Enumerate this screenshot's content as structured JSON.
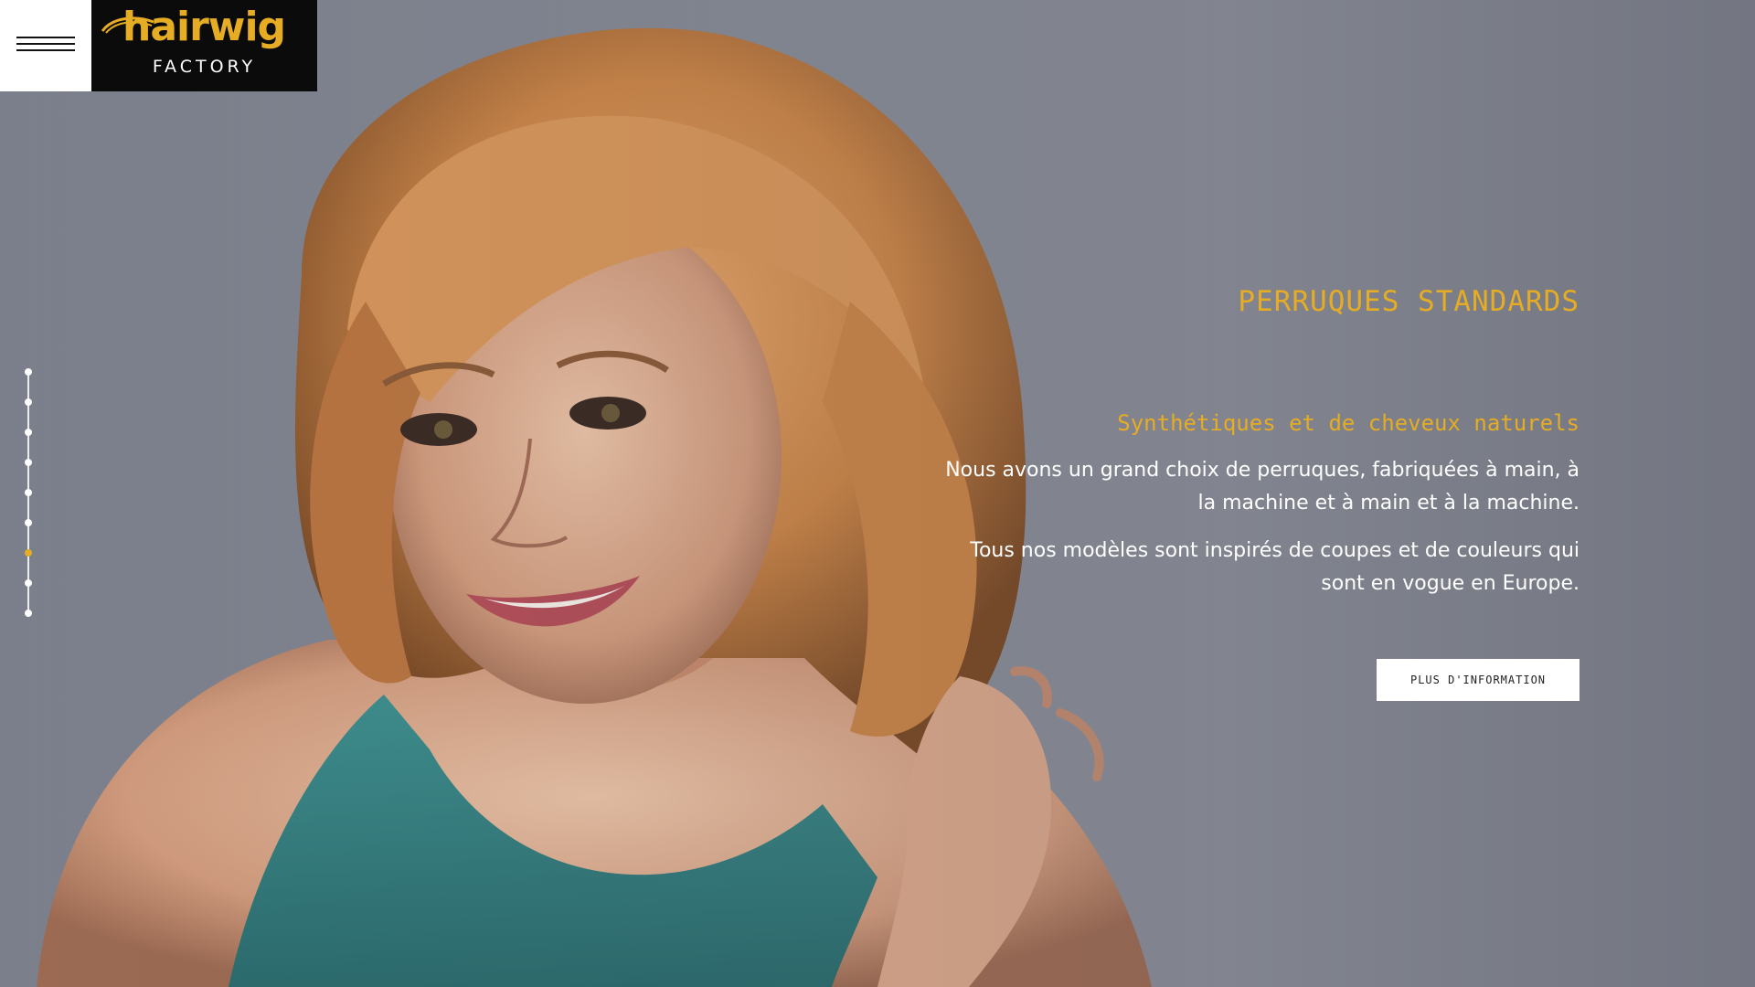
{
  "brand": {
    "logo_main": "hairwig",
    "logo_sub": "FACTORY"
  },
  "header": {
    "menu_icon": "hamburger-menu-icon"
  },
  "dot_nav": {
    "count": 9,
    "active_index": 6,
    "active_color": "#e5ac24"
  },
  "hero": {
    "title": "PERRUQUES STANDARDS",
    "subtitle": "Synthétiques et de cheveux naturels",
    "paragraph_1": "Nous avons un grand choix de perruques, fabriquées à main, à la machine et à main et à la machine.",
    "paragraph_2": "Tous nos modèles sont inspirés de coupes et de couleurs qui sont en vogue en Europe.",
    "cta_label": "PLUS D'INFORMATION"
  },
  "colors": {
    "accent": "#e5ac24",
    "background": "#868a95",
    "logo_bg": "#0b0b0b"
  }
}
